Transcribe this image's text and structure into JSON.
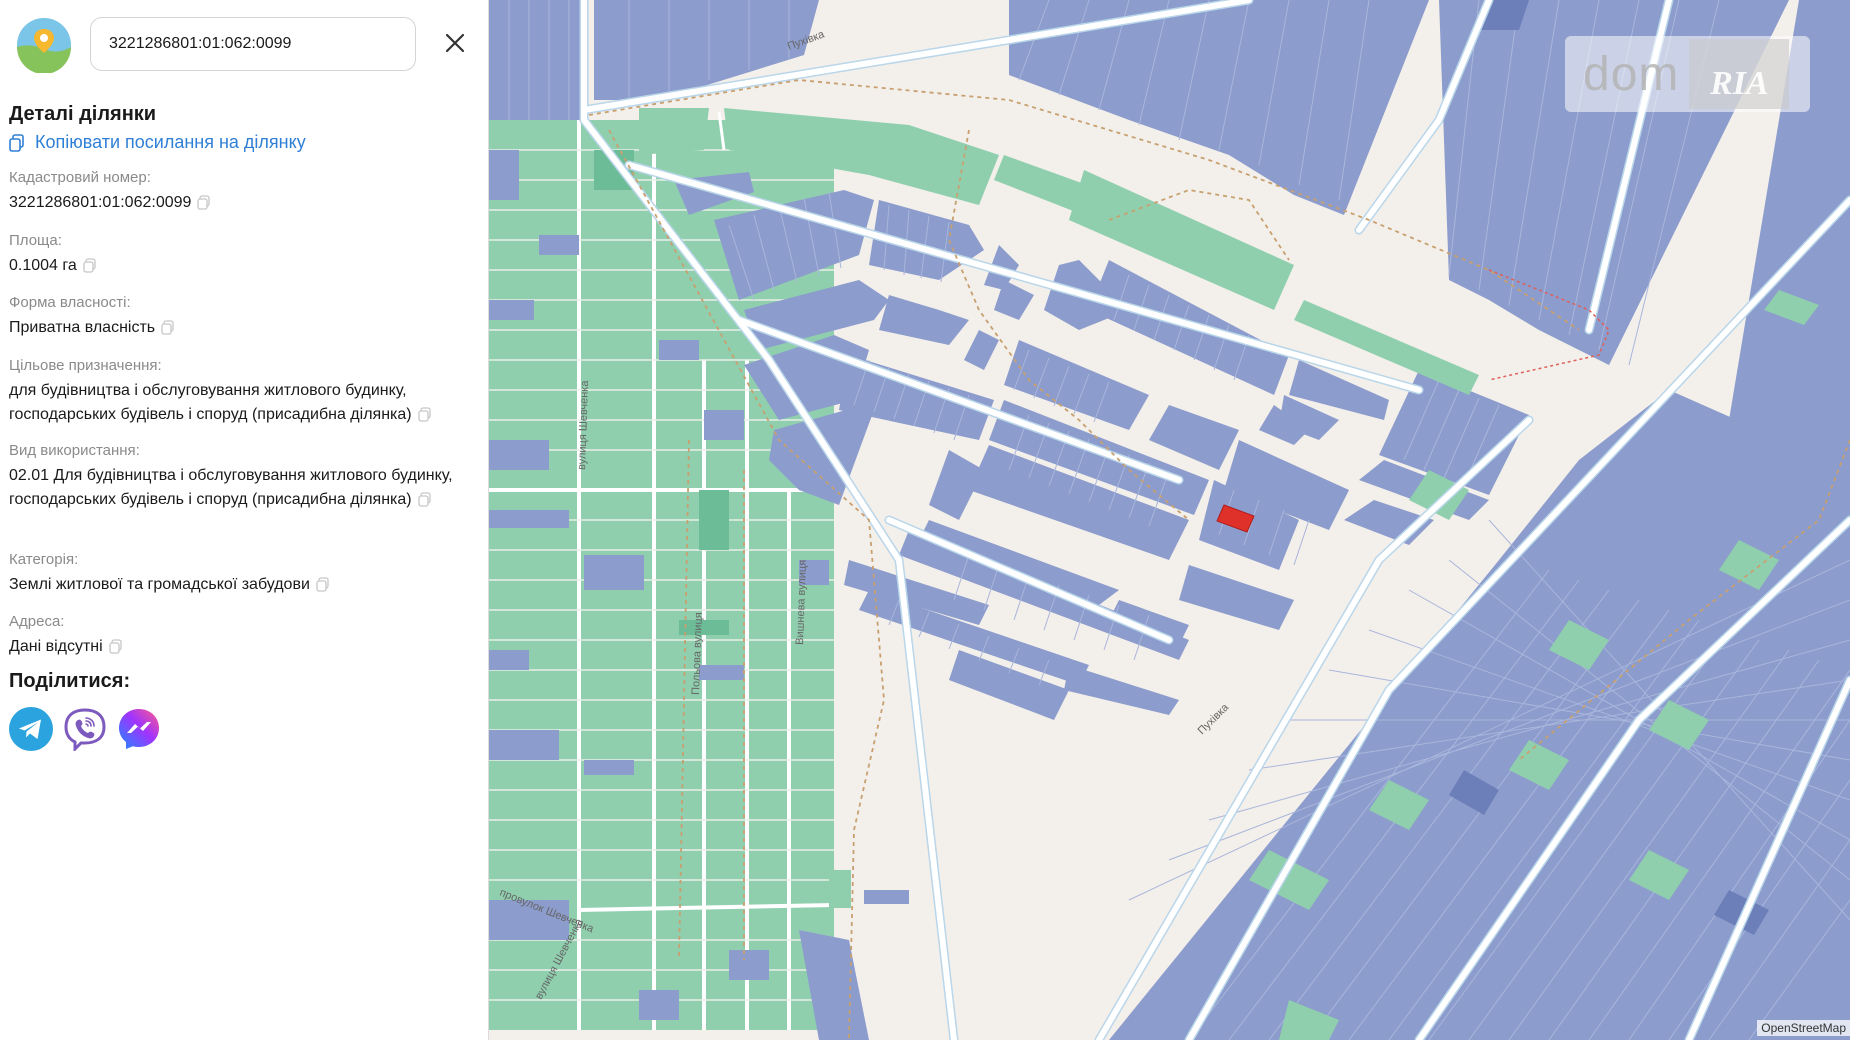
{
  "search": {
    "value": "3221286801:01:062:0099"
  },
  "details": {
    "title": "Деталі ділянки",
    "copy_link_label": "Копіювати посилання на ділянку",
    "fields": [
      {
        "label": "Кадастровий номер:",
        "value": "3221286801:01:062:0099"
      },
      {
        "label": "Площа:",
        "value": "0.1004 га"
      },
      {
        "label": "Форма власності:",
        "value": "Приватна власність"
      },
      {
        "label": "Цільове призначення:",
        "value": "для будівництва і обслуговування житлового будинку, господарських будівель і споруд (присадибна ділянка)"
      },
      {
        "label": "Вид використання:",
        "value": "02.01 Для будівництва і обслуговування житлового будинку, господарських будівель і споруд (присадибна ділянка)"
      },
      {
        "label": "Категорія:",
        "value": "Землі житлової та громадської забудови"
      },
      {
        "label": "Адреса:",
        "value": "Дані відсутні"
      }
    ]
  },
  "share": {
    "title": "Поділитися:",
    "buttons": [
      {
        "icon": "telegram-icon",
        "color": "#2aa3de"
      },
      {
        "icon": "viber-icon",
        "color": "#7d5bbe"
      },
      {
        "icon": "messenger-icon",
        "color": "#7b5cff"
      }
    ]
  },
  "map": {
    "street_labels": [
      "Пухівка",
      "вулиця Шевченка",
      "Польова вулиця",
      "Вишнева вулиця",
      "провулок Шевченка",
      "вулиця Шевченка"
    ],
    "watermark": {
      "dom": "dom",
      "ria": "RIA"
    },
    "attribution": "OpenStreetMap",
    "colors": {
      "background": "#f3efea",
      "parcel_private": "#8c9ccc",
      "parcel_green": "#8fcfae",
      "selected_parcel": "#e0302a",
      "road": "#ffffff",
      "road_edge": "#b9d6ea",
      "boundary": "#c8a070"
    }
  }
}
